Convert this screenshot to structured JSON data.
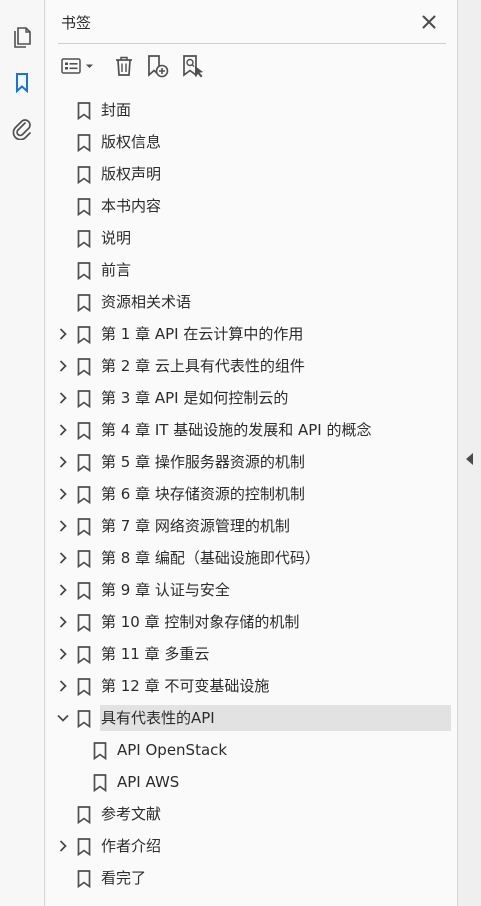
{
  "rail": {
    "items": [
      {
        "name": "pages-icon",
        "active": false
      },
      {
        "name": "bookmarks-icon",
        "active": true
      },
      {
        "name": "attachments-icon",
        "active": false
      }
    ],
    "accent": "#1473e6"
  },
  "panel": {
    "title": "书签"
  },
  "toolbar": {
    "options_icon": "list-options-icon",
    "delete_icon": "trash-icon",
    "new_bookmark_icon": "add-bookmark-icon",
    "bookmark_from_selection_icon": "find-bookmark-icon"
  },
  "bookmarks": [
    {
      "label": "封面",
      "level": 0,
      "expandable": false,
      "expanded": false,
      "selected": false
    },
    {
      "label": "版权信息",
      "level": 0,
      "expandable": false,
      "expanded": false,
      "selected": false
    },
    {
      "label": "版权声明",
      "level": 0,
      "expandable": false,
      "expanded": false,
      "selected": false
    },
    {
      "label": "本书内容",
      "level": 0,
      "expandable": false,
      "expanded": false,
      "selected": false
    },
    {
      "label": "说明",
      "level": 0,
      "expandable": false,
      "expanded": false,
      "selected": false
    },
    {
      "label": "前言",
      "level": 0,
      "expandable": false,
      "expanded": false,
      "selected": false
    },
    {
      "label": "资源相关术语",
      "level": 0,
      "expandable": false,
      "expanded": false,
      "selected": false
    },
    {
      "label": "第 1 章 API 在云计算中的作用",
      "level": 0,
      "expandable": true,
      "expanded": false,
      "selected": false
    },
    {
      "label": "第 2 章 云上具有代表性的组件",
      "level": 0,
      "expandable": true,
      "expanded": false,
      "selected": false
    },
    {
      "label": "第 3 章 API 是如何控制云的",
      "level": 0,
      "expandable": true,
      "expanded": false,
      "selected": false
    },
    {
      "label": "第 4 章 IT 基础设施的发展和 API 的概念",
      "level": 0,
      "expandable": true,
      "expanded": false,
      "selected": false
    },
    {
      "label": "第 5 章 操作服务器资源的机制",
      "level": 0,
      "expandable": true,
      "expanded": false,
      "selected": false
    },
    {
      "label": "第 6 章 块存储资源的控制机制",
      "level": 0,
      "expandable": true,
      "expanded": false,
      "selected": false
    },
    {
      "label": "第 7 章 网络资源管理的机制",
      "level": 0,
      "expandable": true,
      "expanded": false,
      "selected": false
    },
    {
      "label": "第 8 章 编配（基础设施即代码）",
      "level": 0,
      "expandable": true,
      "expanded": false,
      "selected": false
    },
    {
      "label": "第 9 章 认证与安全",
      "level": 0,
      "expandable": true,
      "expanded": false,
      "selected": false
    },
    {
      "label": "第 10 章 控制对象存储的机制",
      "level": 0,
      "expandable": true,
      "expanded": false,
      "selected": false
    },
    {
      "label": "第 11 章 多重云",
      "level": 0,
      "expandable": true,
      "expanded": false,
      "selected": false
    },
    {
      "label": "第 12 章 不可变基础设施",
      "level": 0,
      "expandable": true,
      "expanded": false,
      "selected": false
    },
    {
      "label": "具有代表性的API",
      "level": 0,
      "expandable": true,
      "expanded": true,
      "selected": true
    },
    {
      "label": "API OpenStack",
      "level": 1,
      "expandable": false,
      "expanded": false,
      "selected": false
    },
    {
      "label": "API AWS",
      "level": 1,
      "expandable": false,
      "expanded": false,
      "selected": false
    },
    {
      "label": "参考文献",
      "level": 0,
      "expandable": false,
      "expanded": false,
      "selected": false
    },
    {
      "label": "作者介绍",
      "level": 0,
      "expandable": true,
      "expanded": false,
      "selected": false
    },
    {
      "label": "看完了",
      "level": 0,
      "expandable": false,
      "expanded": false,
      "selected": false
    }
  ]
}
